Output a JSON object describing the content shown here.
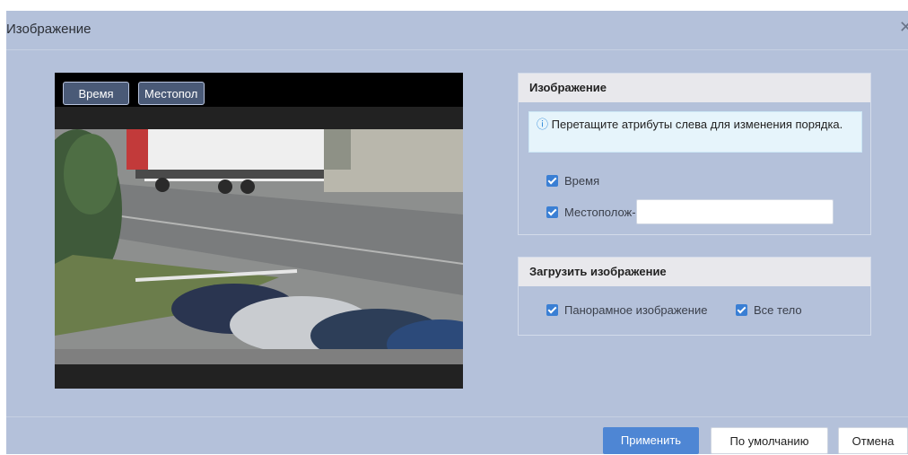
{
  "dialog": {
    "title": "Изображение",
    "close_icon": "close-icon"
  },
  "preview": {
    "osd_time": "Время",
    "osd_location": "Местопол"
  },
  "image_panel": {
    "heading": "Изображение",
    "tip_icon": "info-icon",
    "tip": "Перетащите атрибуты слева для изменения порядка.",
    "time_label": "Время",
    "location_label": "Местополож-",
    "location_value": ""
  },
  "upload_panel": {
    "heading": "Загрузить изображение",
    "panoramic_label": "Панорамное изображение",
    "full_body_label": "Все тело"
  },
  "footer": {
    "apply_label": "Применить",
    "default_label": "По умолчанию",
    "cancel_label": "Отмена"
  },
  "colors": {
    "dialog_bg": "#b4c1da",
    "accent": "#4e86d4",
    "checkbox": "#3a7fd4"
  }
}
